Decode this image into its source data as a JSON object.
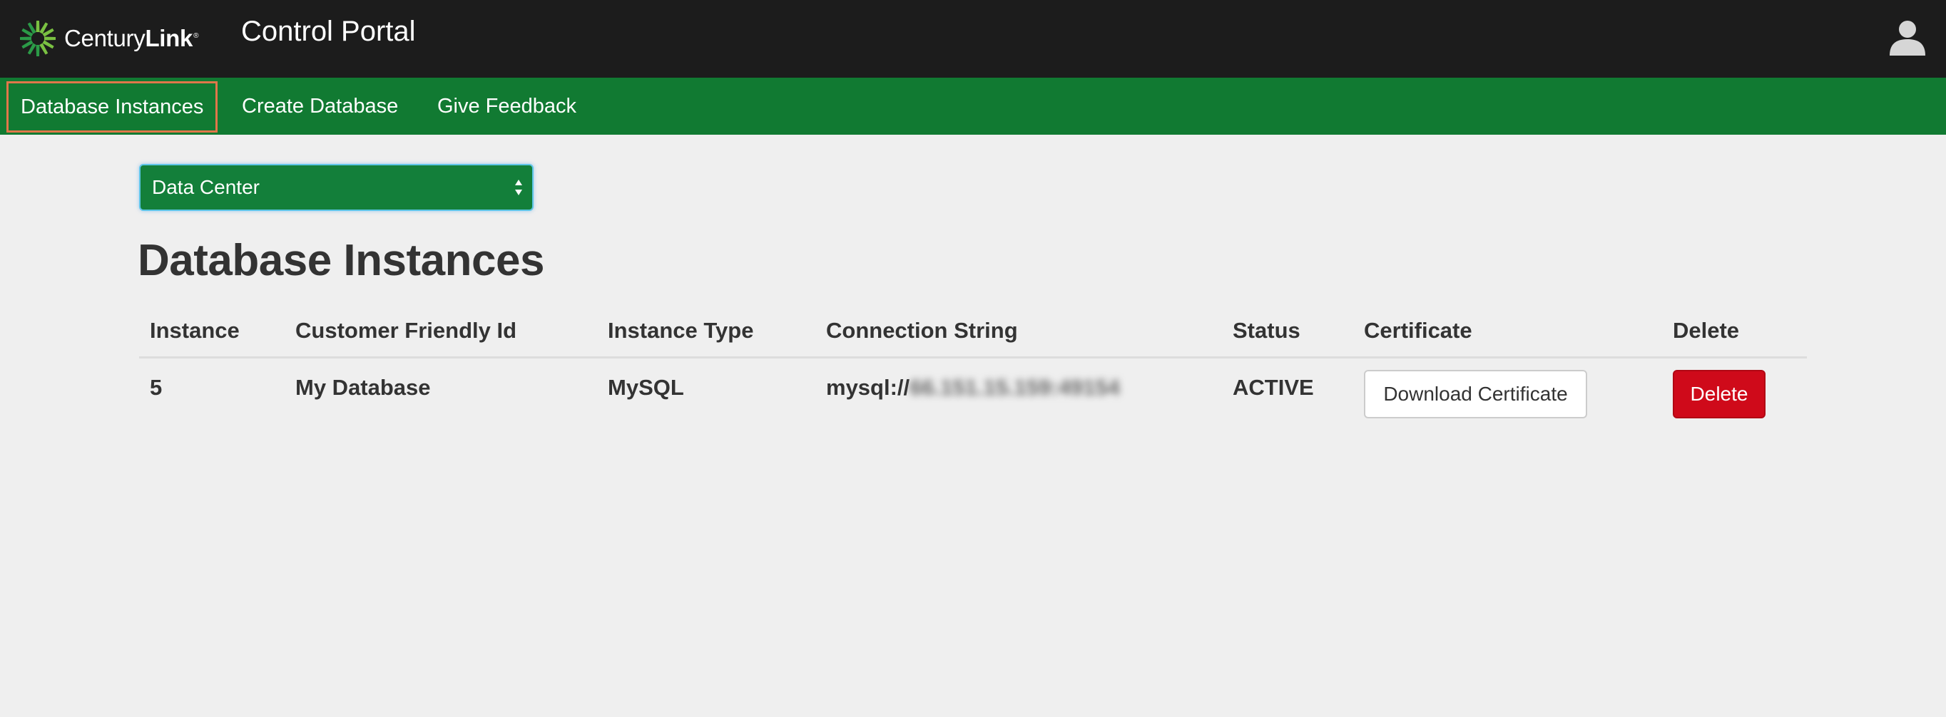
{
  "header": {
    "brand_light": "Century",
    "brand_bold": "Link",
    "brand_reg": "®",
    "title": "Control Portal",
    "avatar_icon": "user-icon"
  },
  "nav": {
    "items": [
      {
        "label": "Database Instances",
        "active": true
      },
      {
        "label": "Create Database"
      },
      {
        "label": "Give Feedback"
      }
    ]
  },
  "filter": {
    "datacenter_value": "Data Center"
  },
  "main": {
    "title": "Database Instances"
  },
  "table": {
    "columns": [
      "Instance",
      "Customer Friendly Id",
      "Instance Type",
      "Connection String",
      "Status",
      "Certificate",
      "Delete"
    ],
    "rows": [
      {
        "instance": "5",
        "friendly_id": "My Database",
        "type": "MySQL",
        "conn_prefix": "mysql://",
        "conn_host": "66.151.15.159:49154",
        "status": "ACTIVE",
        "certificate_button": "Download Certificate",
        "delete_button": "Delete"
      }
    ]
  },
  "colors": {
    "topbar": "#1c1c1c",
    "navbar": "#117a32",
    "active_outline": "#e0774a",
    "delete_button": "#cf0a1a",
    "background": "#efefef"
  }
}
